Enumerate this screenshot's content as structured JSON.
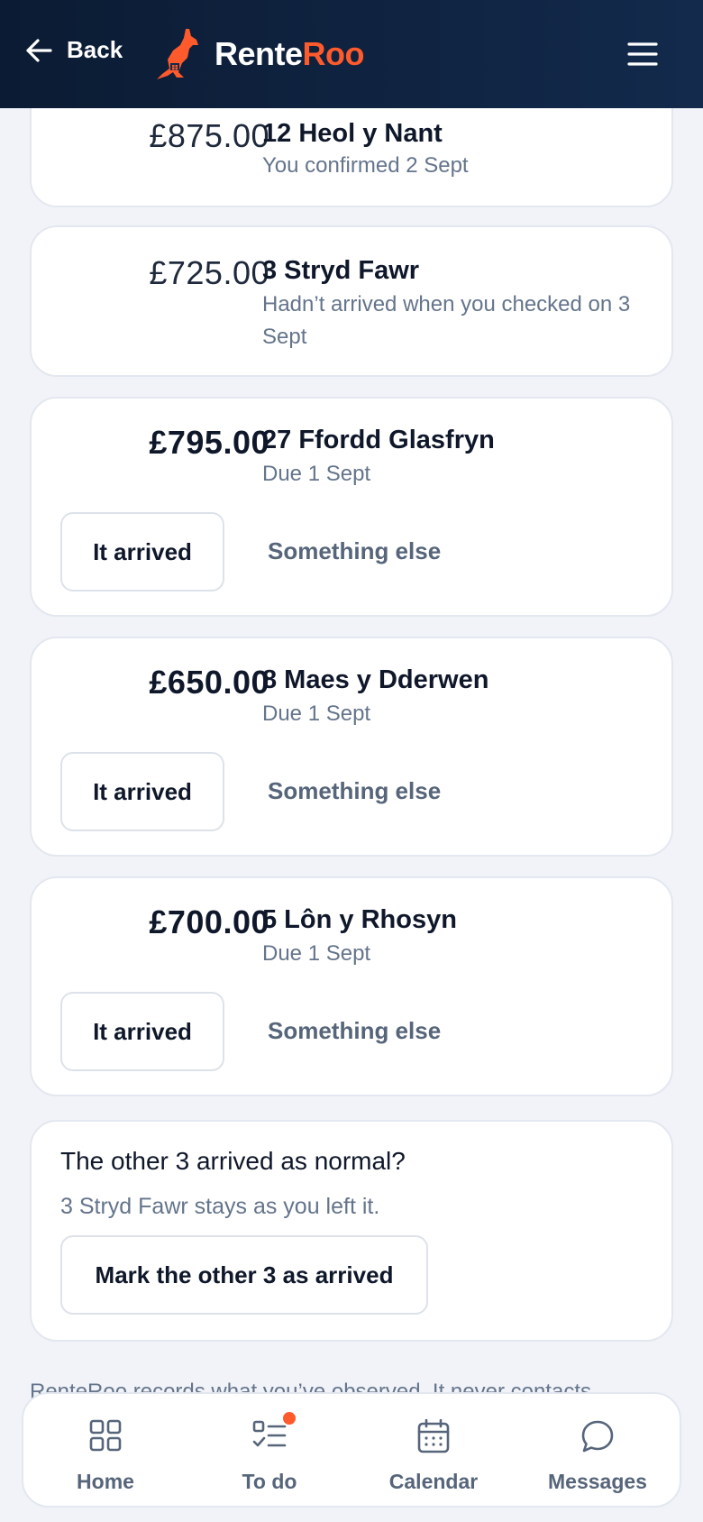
{
  "header": {
    "back_label": "Back",
    "logo_part1": "Rente",
    "logo_part2": "Roo",
    "accent_color": "#ff5a2c",
    "menu_icon": "hamburger-menu-icon"
  },
  "payments": [
    {
      "amount": "£875.00",
      "address": "12 Heol y Nant",
      "status": "You confirmed 2 Sept"
    },
    {
      "amount": "£725.00",
      "address": "3 Stryd Fawr",
      "status": "Hadn’t arrived when you checked on 3 Sept"
    },
    {
      "amount": "£795.00",
      "address": "27 Ffordd Glasfryn",
      "status": "Due 1 Sept",
      "primary_action": "It arrived",
      "secondary_action": "Something else"
    },
    {
      "amount": "£650.00",
      "address": "8 Maes y Dderwen",
      "status": "Due 1 Sept",
      "primary_action": "It arrived",
      "secondary_action": "Something else"
    },
    {
      "amount": "£700.00",
      "address": "5 Lôn y Rhosyn",
      "status": "Due 1 Sept",
      "primary_action": "It arrived",
      "secondary_action": "Something else"
    }
  ],
  "summary": {
    "title": "The other 3 arrived as normal?",
    "subtitle": "3 Stryd Fawr stays as you left it.",
    "button_label": "Mark the other 3 as arrived"
  },
  "footer_note": "RenteRoo records what you’ve observed. It never contacts",
  "tabbar": [
    {
      "label": "Home",
      "icon": "grid-icon"
    },
    {
      "label": "To do",
      "icon": "checklist-icon",
      "has_badge": true
    },
    {
      "label": "Calendar",
      "icon": "calendar-icon"
    },
    {
      "label": "Messages",
      "icon": "chat-bubble-icon"
    }
  ]
}
